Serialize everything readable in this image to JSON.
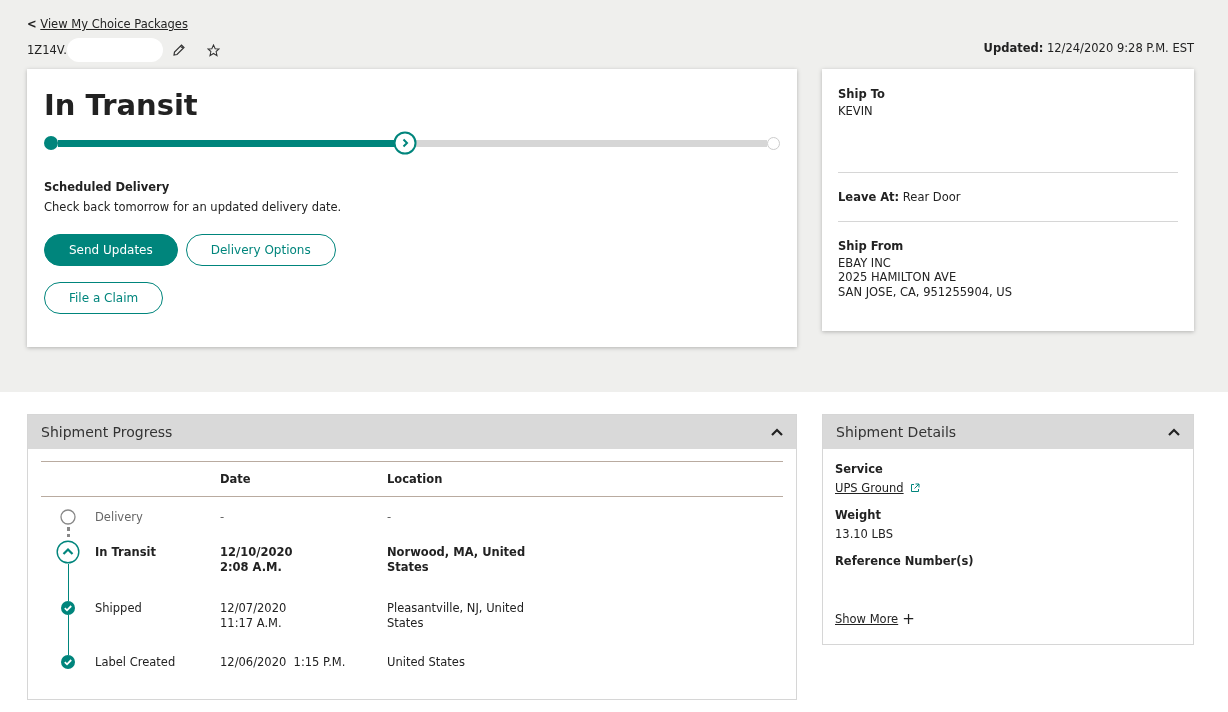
{
  "back_link": {
    "icon": "<",
    "label": "View My Choice Packages"
  },
  "tracking_number": "1Z14V.",
  "updated": {
    "label": "Updated:",
    "value": "12/24/2020 9:28 P.M. EST"
  },
  "status_card": {
    "status": "In Transit",
    "progress": {
      "level": 0.49
    },
    "scheduled_label": "Scheduled Delivery",
    "scheduled_text": "Check back tomorrow for an updated delivery date.",
    "buttons": [
      {
        "label": "Send Updates",
        "kind": "primary"
      },
      {
        "label": "Delivery Options",
        "kind": "secondary"
      },
      {
        "label": "File a Claim",
        "kind": "secondary"
      }
    ]
  },
  "address_card": {
    "ship_to": {
      "label": "Ship To",
      "lines": [
        "KEVIN"
      ]
    },
    "leave_at": {
      "label": "Leave At:",
      "value": "Rear Door"
    },
    "ship_from": {
      "label": "Ship From",
      "lines": [
        "EBAY INC",
        "2025 HAMILTON AVE",
        "SAN JOSE, CA, 951255904, US"
      ]
    }
  },
  "shipment_progress": {
    "title": "Shipment Progress",
    "expanded": true,
    "columns": [
      "Date",
      "Location"
    ],
    "rows": [
      {
        "kind": "pending",
        "event": "Delivery",
        "date": "-",
        "location": "-"
      },
      {
        "kind": "current",
        "event": "In Transit",
        "date": "12/10/2020\n2:08 A.M.",
        "location": "Norwood, MA, United\nStates"
      },
      {
        "kind": "done",
        "event": "Shipped",
        "date": "12/07/2020\n11:17 A.M.",
        "location": "Pleasantville, NJ, United\nStates"
      },
      {
        "kind": "done",
        "event": "Label Created",
        "date": "12/06/2020  1:15 P.M.",
        "location": "United States"
      }
    ]
  },
  "shipment_details": {
    "title": "Shipment Details",
    "expanded": true,
    "service": {
      "label": "Service",
      "value": "UPS Ground"
    },
    "weight": {
      "label": "Weight",
      "value": "13.10 LBS"
    },
    "reference": {
      "label": "Reference Number(s)"
    },
    "show_more": {
      "label": "Show More",
      "icon": "+"
    }
  }
}
